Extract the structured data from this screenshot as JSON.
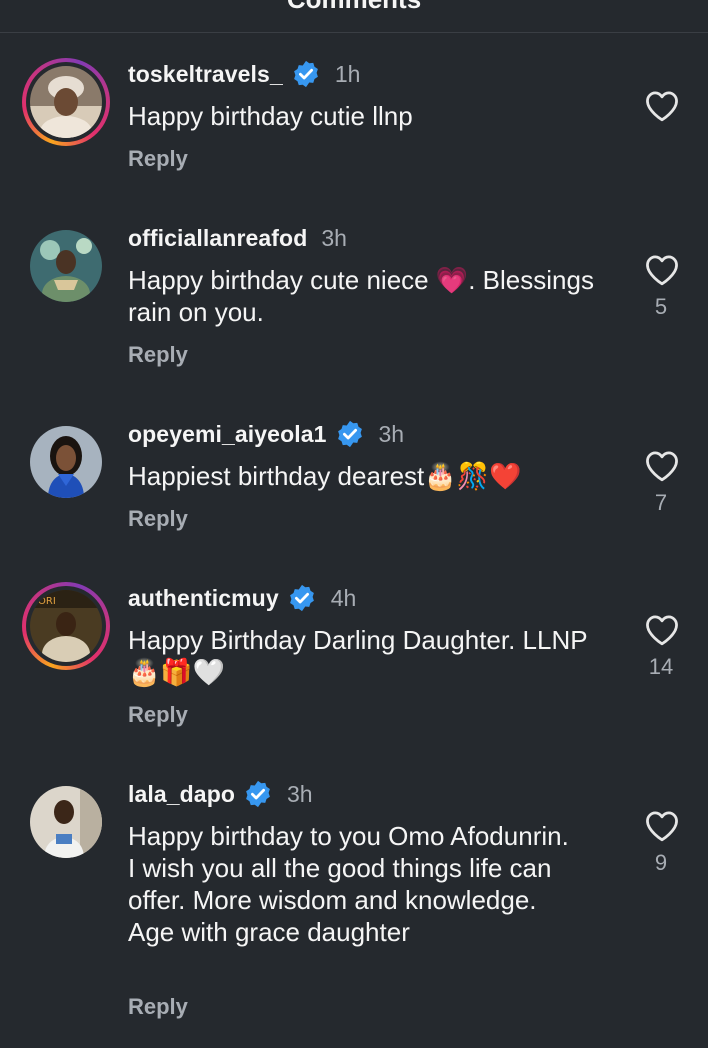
{
  "header": {
    "title": "Comments"
  },
  "comments": [
    {
      "username": "toskeltravels_",
      "verified": true,
      "time": "1h",
      "text": "Happy birthday cutie llnp",
      "reply_label": "Reply",
      "likes": ""
    },
    {
      "username": "officiallanreafod",
      "verified": false,
      "time": "3h",
      "text": "Happy birthday cute niece 💗. Blessings rain on you.",
      "reply_label": "Reply",
      "likes": "5"
    },
    {
      "username": "opeyemi_aiyeola1",
      "verified": true,
      "time": "3h",
      "text": "Happiest birthday dearest🎂🎊❤️",
      "reply_label": "Reply",
      "likes": "7"
    },
    {
      "username": "authenticmuy",
      "verified": true,
      "time": "4h",
      "text": "Happy Birthday Darling Daughter. LLNP 🎂🎁🤍",
      "reply_label": "Reply",
      "likes": "14"
    },
    {
      "username": "lala_dapo",
      "verified": true,
      "time": "3h",
      "text": "Happy birthday to you Omo Afodunrin. I wish you all the good things life can offer. More wisdom and knowledge. Age with grace daughter",
      "reply_label": "Reply",
      "likes": "9"
    }
  ],
  "icons": {
    "verified": "verified-badge-icon",
    "like": "heart-outline-icon"
  },
  "colors": {
    "background": "#25292e",
    "verified_blue": "#3797f0",
    "secondary_text": "#a8adb4",
    "story_ring_start": "#f9a51e",
    "story_ring_end": "#c13584"
  }
}
